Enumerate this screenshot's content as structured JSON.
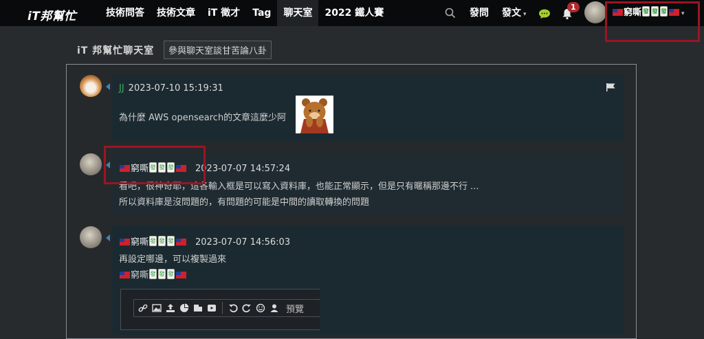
{
  "header": {
    "logo": "iT邦幫忙",
    "nav": [
      "技術問答",
      "技術文章",
      "iT 徵才",
      "Tag",
      "聊天室",
      "2022 鐵人賽"
    ],
    "ask": "發問",
    "post": "發文",
    "notification_count": "1",
    "user_name": "窮嘶"
  },
  "room": {
    "title": "iT 邦幫忙聊天室",
    "tag": "參與聊天室談甘苦論八卦"
  },
  "messages": [
    {
      "user": "JJ",
      "time": "2023-07-10 15:19:31",
      "lines": [
        "為什麼 AWS opensearch的文章這麼少阿"
      ]
    },
    {
      "user": "窮嘶",
      "time": "2023-07-07 14:57:24",
      "lines": [
        "看吧，很神奇耶，這各輸入框是可以寫入資料庫，也能正常顯示，但是只有暱稱那邊不行 ...",
        "所以資料庫是沒問題的，有問題的可能是中間的讀取轉換的問題"
      ]
    },
    {
      "user": "窮嘶",
      "time": "2023-07-07 14:56:03",
      "lines": [
        "再設定哪邊，可以複製過來"
      ],
      "quoted_name": "窮嘶",
      "editor_preview": "預覽"
    }
  ],
  "tile_glyph": "發",
  "colors": {
    "accent_green": "#3fae5d",
    "highlight_red": "#9a1524",
    "topbar": "#090a0b"
  },
  "icons": [
    "search-icon",
    "chat-icon",
    "bell-icon",
    "flag-icon",
    "link-icon",
    "image-icon",
    "upload-icon",
    "chart-icon",
    "youtube-icon",
    "undo-icon",
    "redo-icon",
    "emoji-icon",
    "user-icon"
  ]
}
